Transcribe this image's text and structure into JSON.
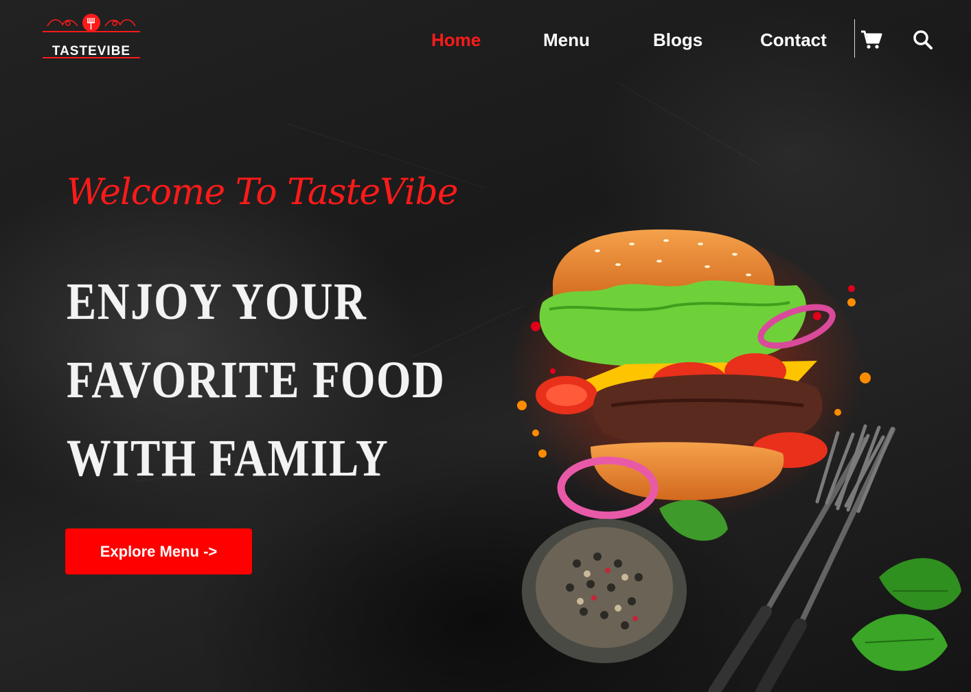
{
  "brand": {
    "name": "TASTEVIBE",
    "accent": "#ff1a1a"
  },
  "nav": {
    "items": [
      {
        "label": "Home",
        "active": true
      },
      {
        "label": "Menu",
        "active": false
      },
      {
        "label": "Blogs",
        "active": false
      },
      {
        "label": "Contact",
        "active": false
      }
    ],
    "icons": {
      "cart": "cart-icon",
      "search": "search-icon"
    }
  },
  "hero": {
    "welcome": "Welcome To TasteVibe",
    "headline": [
      "ENJOY YOUR",
      "FAVORITE FOOD",
      "WITH FAMILY"
    ],
    "cta_label": "Explore Menu ->",
    "cta_color": "#ff0000",
    "image": "burger-with-forks-illustration"
  }
}
